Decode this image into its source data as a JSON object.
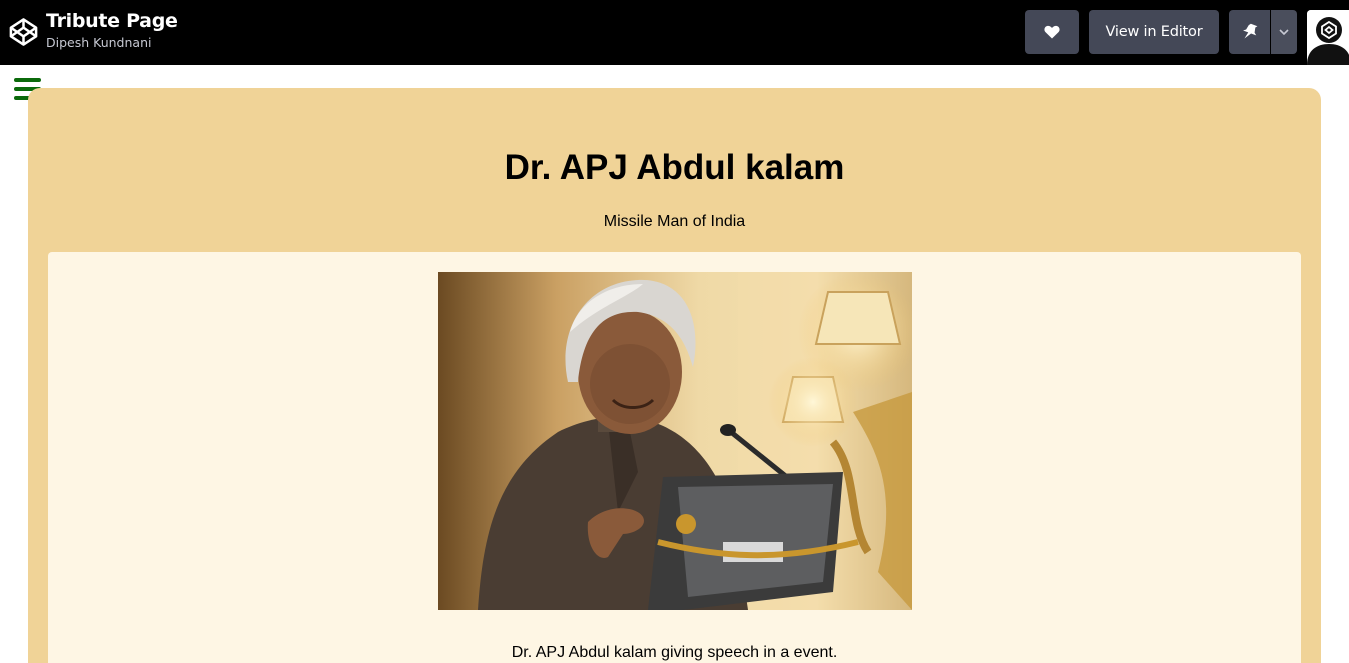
{
  "header": {
    "title": "Tribute Page",
    "author": "Dipesh Kundnani",
    "view_in_editor_label": "View in Editor",
    "icons": [
      "codepen-logo-icon",
      "heart-icon",
      "pin-icon",
      "chevron-down-icon",
      "avatar"
    ]
  },
  "tribute": {
    "title": "Dr. APJ Abdul kalam",
    "subtitle": "Missile Man of India",
    "image_caption": "Dr. APJ Abdul kalam giving speech in a event."
  },
  "colors": {
    "topbar": "#000000",
    "button": "#444857",
    "main_background": "#f0d397",
    "image_panel": "#fef6e4",
    "menu_icon": "#0b6a0b"
  }
}
